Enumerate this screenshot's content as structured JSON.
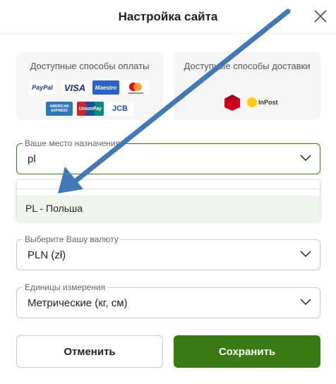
{
  "dialog": {
    "title": "Настройка сайта"
  },
  "payment": {
    "title": "Доступные способы оплаты",
    "logos": [
      {
        "name": "PayPal",
        "label": "PayPal"
      },
      {
        "name": "Visa",
        "label": "VISA"
      },
      {
        "name": "Maestro",
        "label": "Maestro"
      },
      {
        "name": "Mastercard",
        "label": "mastercard"
      },
      {
        "name": "American Express",
        "label": "AMERICAN EXPRESS"
      },
      {
        "name": "UnionPay",
        "label": "UnionPay"
      },
      {
        "name": "JCB",
        "label": "JCB"
      }
    ]
  },
  "shipping": {
    "title": "Доступные способы доставки",
    "logos": [
      {
        "name": "DPD",
        "label": ""
      },
      {
        "name": "InPost",
        "label": "InPost"
      }
    ]
  },
  "destination": {
    "label": "Ваше место назначения",
    "value": "pl",
    "options": [
      "PL - Польша"
    ]
  },
  "currency": {
    "label": "Выберите Вашу валюту",
    "value": "PLN (zł)"
  },
  "units": {
    "label": "Единицы измерения",
    "value": "Метрические (кг, см)"
  },
  "buttons": {
    "cancel": "Отменить",
    "save": "Сохранить"
  },
  "colors": {
    "accent": "#3a7a12",
    "annotation_arrow": "#3f79b8",
    "highlight": "#eef5ea"
  }
}
